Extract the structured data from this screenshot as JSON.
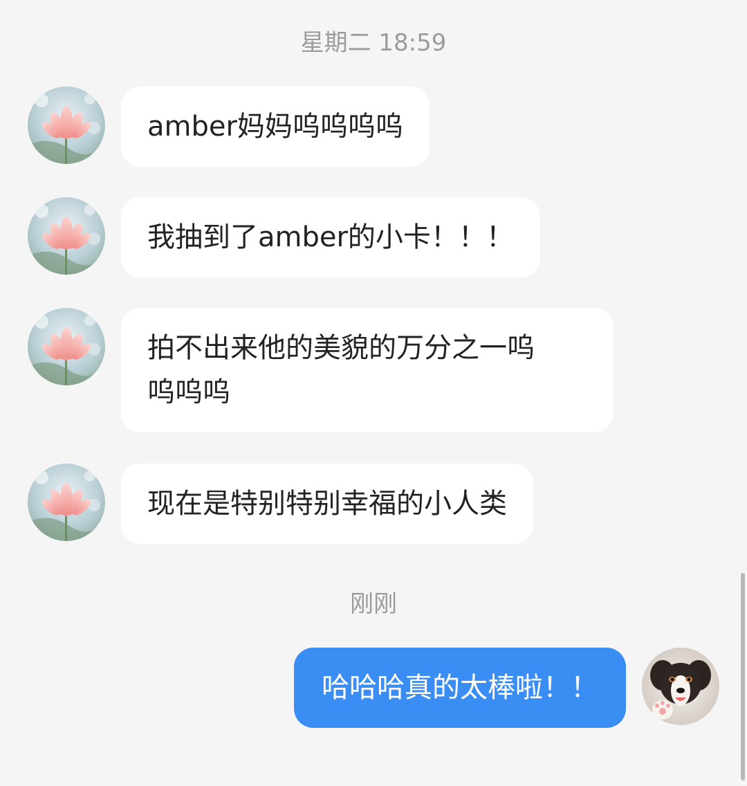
{
  "chat": {
    "timestamps": {
      "first": "星期二 18:59",
      "second": "刚刚"
    },
    "incoming": [
      {
        "text": "amber妈妈呜呜呜呜",
        "avatar": "lotus-avatar-icon"
      },
      {
        "text": "我抽到了amber的小卡！！！",
        "avatar": "lotus-avatar-icon"
      },
      {
        "text": "拍不出来他的美貌的万分之一呜\n呜呜呜",
        "avatar": "lotus-avatar-icon"
      },
      {
        "text": "现在是特别特别幸福的小人类",
        "avatar": "lotus-avatar-icon"
      }
    ],
    "outgoing": [
      {
        "text": "哈哈哈真的太棒啦！！",
        "avatar": "dog-avatar-icon"
      }
    ]
  },
  "colors": {
    "background": "#f5f5f5",
    "incoming_bubble": "#ffffff",
    "outgoing_bubble": "#3a8df3",
    "timestamp_text": "#9b9b9b"
  }
}
